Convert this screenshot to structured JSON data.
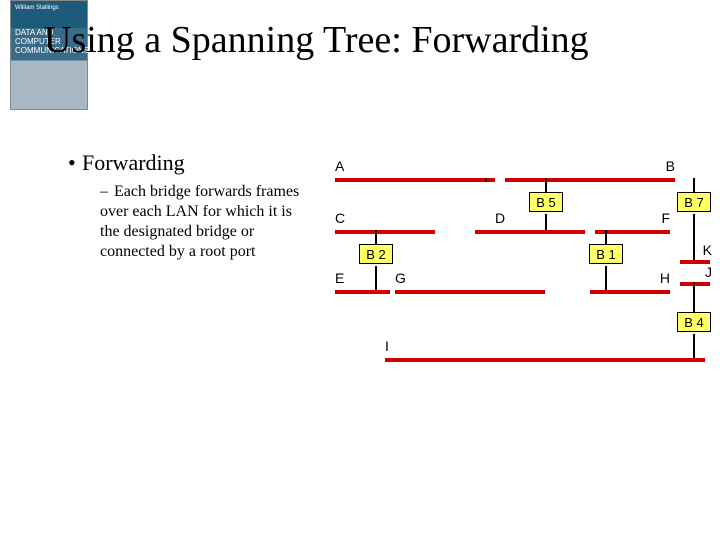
{
  "title": "Using a Spanning Tree: Forwarding",
  "book": {
    "line1": "William Stallings",
    "line2": "DATA AND COMPUTER COMMUNICATIONS"
  },
  "bullet": {
    "main": "Forwarding",
    "sub": "Each bridge forwards frames over each LAN for which it is the designated bridge or connected by a root port"
  },
  "diagram": {
    "lans": {
      "A": "A",
      "B": "B",
      "C": "C",
      "D": "D",
      "E": "E",
      "F": "F",
      "G": "G",
      "H": "H",
      "I": "I",
      "J": "J",
      "K": "K"
    },
    "bridges": {
      "B1": "B 1",
      "B2": "B 2",
      "B4": "B 4",
      "B5": "B 5",
      "B7": "B 7"
    }
  }
}
